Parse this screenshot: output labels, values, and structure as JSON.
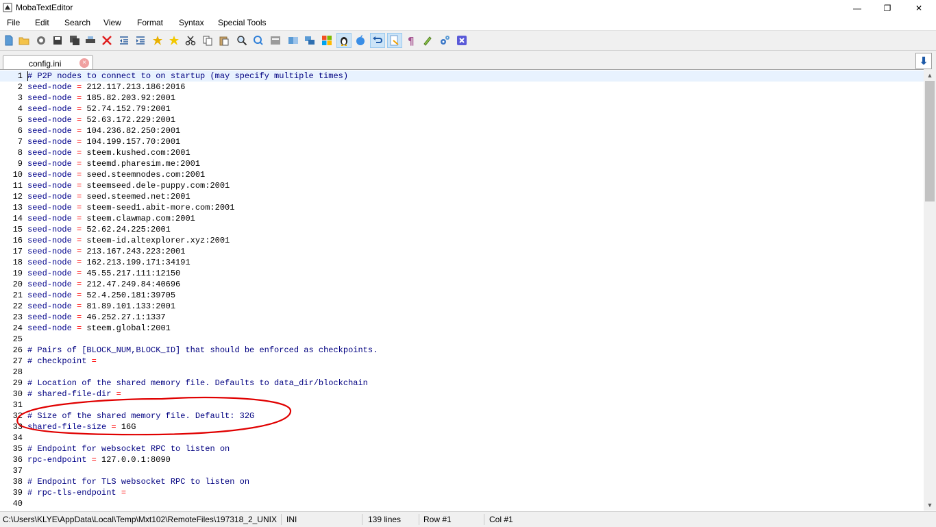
{
  "window": {
    "title": "MobaTextEditor",
    "minimize": "—",
    "maximize": "❐",
    "close": "✕"
  },
  "menu": [
    "File",
    "Edit",
    "Search",
    "View",
    "Format",
    "Syntax",
    "Special Tools"
  ],
  "tab": {
    "label": "config.ini",
    "close": "×",
    "arrow": "⬇"
  },
  "colors": {
    "key": "#00008b",
    "operator": "#ff0000",
    "comment": "#000080",
    "annotation": "#e00000",
    "current_line": "#e8f2fe"
  },
  "editor": {
    "lines": [
      {
        "n": "1",
        "type": "comment",
        "text": "# P2P nodes to connect to on startup (may specify multiple times)"
      },
      {
        "n": "2",
        "type": "kv",
        "key": "seed-node",
        "value": "212.117.213.186:2016"
      },
      {
        "n": "3",
        "type": "kv",
        "key": "seed-node",
        "value": "185.82.203.92:2001"
      },
      {
        "n": "4",
        "type": "kv",
        "key": "seed-node",
        "value": "52.74.152.79:2001"
      },
      {
        "n": "5",
        "type": "kv",
        "key": "seed-node",
        "value": "52.63.172.229:2001"
      },
      {
        "n": "6",
        "type": "kv",
        "key": "seed-node",
        "value": "104.236.82.250:2001"
      },
      {
        "n": "7",
        "type": "kv",
        "key": "seed-node",
        "value": "104.199.157.70:2001"
      },
      {
        "n": "8",
        "type": "kv",
        "key": "seed-node",
        "value": "steem.kushed.com:2001"
      },
      {
        "n": "9",
        "type": "kv",
        "key": "seed-node",
        "value": "steemd.pharesim.me:2001"
      },
      {
        "n": "10",
        "type": "kv",
        "key": "seed-node",
        "value": "seed.steemnodes.com:2001"
      },
      {
        "n": "11",
        "type": "kv",
        "key": "seed-node",
        "value": "steemseed.dele-puppy.com:2001"
      },
      {
        "n": "12",
        "type": "kv",
        "key": "seed-node",
        "value": "seed.steemed.net:2001"
      },
      {
        "n": "13",
        "type": "kv",
        "key": "seed-node",
        "value": "steem-seed1.abit-more.com:2001"
      },
      {
        "n": "14",
        "type": "kv",
        "key": "seed-node",
        "value": "steem.clawmap.com:2001"
      },
      {
        "n": "15",
        "type": "kv",
        "key": "seed-node",
        "value": "52.62.24.225:2001"
      },
      {
        "n": "16",
        "type": "kv",
        "key": "seed-node",
        "value": "steem-id.altexplorer.xyz:2001"
      },
      {
        "n": "17",
        "type": "kv",
        "key": "seed-node",
        "value": "213.167.243.223:2001"
      },
      {
        "n": "18",
        "type": "kv",
        "key": "seed-node",
        "value": "162.213.199.171:34191"
      },
      {
        "n": "19",
        "type": "kv",
        "key": "seed-node",
        "value": "45.55.217.111:12150"
      },
      {
        "n": "20",
        "type": "kv",
        "key": "seed-node",
        "value": "212.47.249.84:40696"
      },
      {
        "n": "21",
        "type": "kv",
        "key": "seed-node",
        "value": "52.4.250.181:39705"
      },
      {
        "n": "22",
        "type": "kv",
        "key": "seed-node",
        "value": "81.89.101.133:2001"
      },
      {
        "n": "23",
        "type": "kv",
        "key": "seed-node",
        "value": "46.252.27.1:1337"
      },
      {
        "n": "24",
        "type": "kv",
        "key": "seed-node",
        "value": "steem.global:2001"
      },
      {
        "n": "25",
        "type": "blank",
        "text": ""
      },
      {
        "n": "26",
        "type": "comment",
        "text": "# Pairs of [BLOCK_NUM,BLOCK_ID] that should be enforced as checkpoints."
      },
      {
        "n": "27",
        "type": "ckv",
        "key": "# checkpoint",
        "value": ""
      },
      {
        "n": "28",
        "type": "blank",
        "text": ""
      },
      {
        "n": "29",
        "type": "comment",
        "text": "# Location of the shared memory file. Defaults to data_dir/blockchain"
      },
      {
        "n": "30",
        "type": "ckv",
        "key": "# shared-file-dir",
        "value": ""
      },
      {
        "n": "31",
        "type": "blank",
        "text": ""
      },
      {
        "n": "32",
        "type": "comment",
        "text": "# Size of the shared memory file. Default: 32G"
      },
      {
        "n": "33",
        "type": "kv",
        "key": "shared-file-size",
        "value": "16G"
      },
      {
        "n": "34",
        "type": "blank",
        "text": ""
      },
      {
        "n": "35",
        "type": "comment",
        "text": "# Endpoint for websocket RPC to listen on"
      },
      {
        "n": "36",
        "type": "kv",
        "key": "rpc-endpoint",
        "value": "127.0.0.1:8090"
      },
      {
        "n": "37",
        "type": "blank",
        "text": ""
      },
      {
        "n": "38",
        "type": "comment",
        "text": "# Endpoint for TLS websocket RPC to listen on"
      },
      {
        "n": "39",
        "type": "ckv",
        "key": "# rpc-tls-endpoint",
        "value": ""
      },
      {
        "n": "40",
        "type": "blank",
        "text": ""
      }
    ]
  },
  "status": {
    "path": "C:\\Users\\KLYE\\AppData\\Local\\Temp\\Mxt102\\RemoteFiles\\197318_2_UNIX",
    "syntax": "INI",
    "lines": "139 lines",
    "row": "Row #1",
    "col": "Col #1"
  }
}
